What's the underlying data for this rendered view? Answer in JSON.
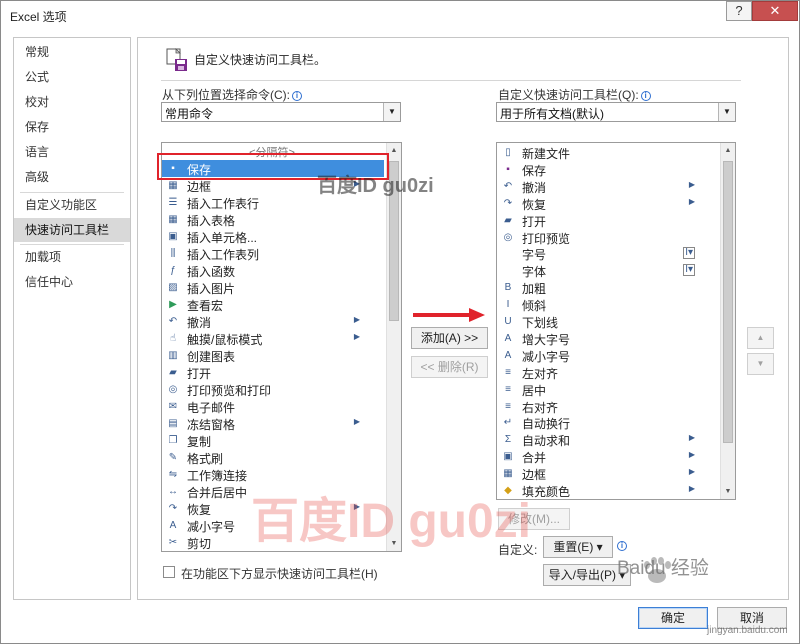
{
  "window": {
    "title": "Excel 选项",
    "help": "?",
    "close": "✕"
  },
  "nav": {
    "items": [
      {
        "label": "常规"
      },
      {
        "label": "公式"
      },
      {
        "label": "校对"
      },
      {
        "label": "保存"
      },
      {
        "label": "语言"
      },
      {
        "label": "高级"
      },
      {
        "label": "自定义功能区"
      },
      {
        "label": "快速访问工具栏",
        "selected": true
      },
      {
        "label": "加载项"
      },
      {
        "label": "信任中心"
      }
    ]
  },
  "header": {
    "title": "自定义快速访问工具栏。",
    "icon": "quick-access-toolbar-icon"
  },
  "left": {
    "label": "从下列位置选择命令(C):",
    "combo_value": "常用命令",
    "separator": "<分隔符>",
    "commands": [
      {
        "icon": "save-icon",
        "label": "保存",
        "selected": true
      },
      {
        "icon": "border-icon",
        "label": "边框",
        "submenu": true
      },
      {
        "icon": "insert-rows-icon",
        "label": "插入工作表行"
      },
      {
        "icon": "insert-table-icon",
        "label": "插入表格"
      },
      {
        "icon": "insert-cells-icon",
        "label": "插入单元格..."
      },
      {
        "icon": "insert-columns-icon",
        "label": "插入工作表列"
      },
      {
        "icon": "function-icon",
        "label": "插入函数"
      },
      {
        "icon": "picture-icon",
        "label": "插入图片"
      },
      {
        "icon": "play-macro-icon",
        "label": "查看宏"
      },
      {
        "icon": "undo-icon",
        "label": "撤消",
        "submenu": true
      },
      {
        "icon": "touch-mouse-icon",
        "label": "触摸/鼠标模式",
        "submenu": true
      },
      {
        "icon": "chart-icon",
        "label": "创建图表"
      },
      {
        "icon": "open-folder-icon",
        "label": "打开"
      },
      {
        "icon": "print-preview-icon",
        "label": "打印预览和打印"
      },
      {
        "icon": "email-icon",
        "label": "电子邮件"
      },
      {
        "icon": "freeze-panes-icon",
        "label": "冻结窗格",
        "submenu": true
      },
      {
        "icon": "copy-icon",
        "label": "复制"
      },
      {
        "icon": "format-painter-icon",
        "label": "格式刷"
      },
      {
        "icon": "workbook-connections-icon",
        "label": "工作簿连接"
      },
      {
        "icon": "merge-center-icon",
        "label": "合并后居中"
      },
      {
        "icon": "redo-icon",
        "label": "恢复",
        "submenu": true
      },
      {
        "icon": "decrease-font-icon",
        "label": "减小字号"
      },
      {
        "icon": "cut-icon",
        "label": "剪切"
      }
    ]
  },
  "right": {
    "label": "自定义快速访问工具栏(Q):",
    "combo_value": "用于所有文档(默认)",
    "commands": [
      {
        "icon": "new-file-icon",
        "label": "新建文件"
      },
      {
        "icon": "save-icon",
        "label": "保存"
      },
      {
        "icon": "undo-icon",
        "label": "撤消",
        "submenu": true
      },
      {
        "icon": "redo-icon",
        "label": "恢复",
        "submenu": true
      },
      {
        "icon": "open-folder-icon",
        "label": "打开"
      },
      {
        "icon": "print-preview-icon",
        "label": "打印预览"
      },
      {
        "icon": "",
        "label": "字号",
        "dropdown": true
      },
      {
        "icon": "",
        "label": "字体",
        "dropdown": true
      },
      {
        "icon": "bold-icon",
        "label": "加粗"
      },
      {
        "icon": "italic-icon",
        "label": "倾斜"
      },
      {
        "icon": "underline-icon",
        "label": "下划线"
      },
      {
        "icon": "increase-font-icon",
        "label": "增大字号"
      },
      {
        "icon": "decrease-font-icon",
        "label": "减小字号"
      },
      {
        "icon": "align-left-icon",
        "label": "左对齐"
      },
      {
        "icon": "align-center-icon",
        "label": "居中"
      },
      {
        "icon": "align-right-icon",
        "label": "右对齐"
      },
      {
        "icon": "wrap-text-icon",
        "label": "自动换行"
      },
      {
        "icon": "autosum-icon",
        "label": "自动求和",
        "submenu": true
      },
      {
        "icon": "merge-icon",
        "label": "合并",
        "submenu": true
      },
      {
        "icon": "border-icon",
        "label": "边框",
        "submenu": true
      },
      {
        "icon": "fill-color-icon",
        "label": "填充颜色",
        "submenu": true
      }
    ]
  },
  "buttons": {
    "add": "添加(A) >>",
    "remove": "<< 删除(R)",
    "modify": "修改(M)...",
    "customize_label": "自定义:",
    "reset": "重置(E) ▾",
    "import_export": "导入/导出(P) ▾",
    "ok": "确定",
    "cancel": "取消",
    "move_up": "▲",
    "move_down": "▼"
  },
  "checkbox": {
    "label": "在功能区下方显示快速访问工具栏(H)",
    "checked": false
  },
  "watermarks": {
    "top": "百度ID gu0zi",
    "middle": "百度ID gu0zi",
    "brand": "Baidu 经验",
    "url": "jingyan.baidu.com"
  },
  "colors": {
    "selection": "#3f8ede",
    "highlight_box": "#e0232b",
    "arrow": "#e0232b"
  }
}
